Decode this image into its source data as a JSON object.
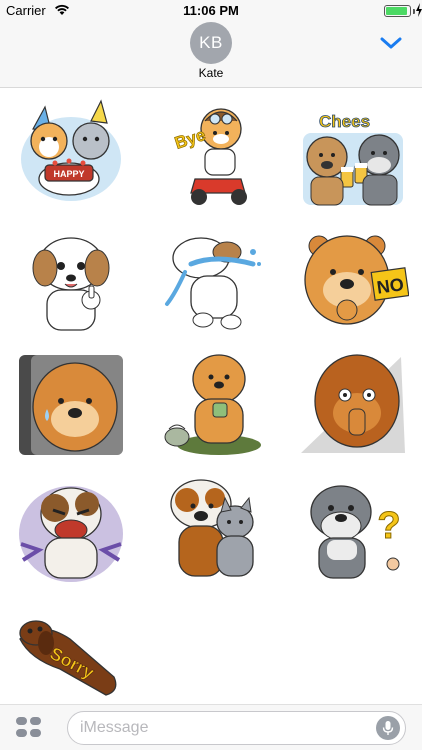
{
  "status_bar": {
    "carrier": "Carrier",
    "time": "11:06 PM",
    "battery_level": 0.9,
    "battery_color": "#4cd964"
  },
  "header": {
    "avatar_initials": "KB",
    "contact_name": "Kate",
    "avatar_color": "#a2a6ad",
    "accent_color": "#1a7cf0",
    "collapse_icon": "chevron-down-icon"
  },
  "stickers": [
    {
      "id": "corgi-cat-happy-birthday",
      "caption": "HAPPY"
    },
    {
      "id": "corgi-scooter-bye",
      "caption": "Bye"
    },
    {
      "id": "terrier-schnauzer-cheers",
      "caption": "Chees"
    },
    {
      "id": "shih-tzu-thumbs-up",
      "caption": ""
    },
    {
      "id": "shih-tzu-crying",
      "caption": ""
    },
    {
      "id": "chow-chow-no",
      "caption": "NO"
    },
    {
      "id": "chow-chow-sweating",
      "caption": ""
    },
    {
      "id": "chow-chow-drinking-tea",
      "caption": ""
    },
    {
      "id": "chow-chow-thinking",
      "caption": ""
    },
    {
      "id": "bulldog-angry",
      "caption": ""
    },
    {
      "id": "bulldog-cat-hug",
      "caption": ""
    },
    {
      "id": "schnauzer-question",
      "caption": "?"
    },
    {
      "id": "dachshund-sorry",
      "caption": "Sorry"
    }
  ],
  "composer": {
    "placeholder": "iMessage",
    "value": "",
    "apps_icon": "app-drawer-icon",
    "mic_icon": "microphone-icon"
  }
}
